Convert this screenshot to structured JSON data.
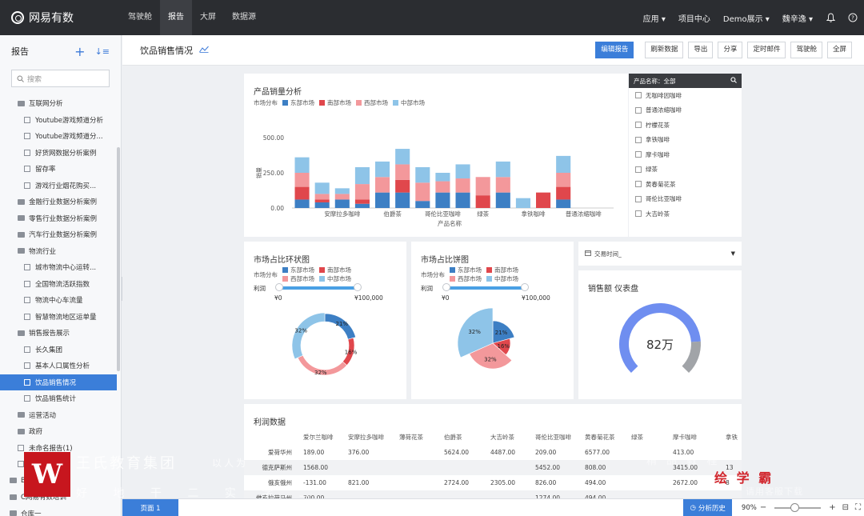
{
  "app": {
    "name": "网易有数"
  },
  "nav": [
    "驾驶舱",
    "报告",
    "大屏",
    "数据源"
  ],
  "nav_active": 1,
  "top_right": {
    "apps": "应用 ▾",
    "project": "项目中心",
    "demo": "Demo展示 ▾",
    "user": "魏辛逸 ▾"
  },
  "sidebar": {
    "title": "报告",
    "search_placeholder": "搜索",
    "items": [
      {
        "type": "folder",
        "level": 1,
        "label": "互联网分析"
      },
      {
        "type": "file",
        "level": 2,
        "label": "Youtube游戏频道分析"
      },
      {
        "type": "file",
        "level": 2,
        "label": "Youtube游戏频道分..."
      },
      {
        "type": "file",
        "level": 2,
        "label": "好货网数据分析案例"
      },
      {
        "type": "file",
        "level": 2,
        "label": "留存率"
      },
      {
        "type": "file",
        "level": 2,
        "label": "游戏行业烟花购买..."
      },
      {
        "type": "folder",
        "level": 1,
        "label": "金融行业数据分析案例"
      },
      {
        "type": "folder",
        "level": 1,
        "label": "零售行业数据分析案例"
      },
      {
        "type": "folder",
        "level": 1,
        "label": "汽车行业数据分析案例"
      },
      {
        "type": "folder",
        "level": 1,
        "label": "物流行业"
      },
      {
        "type": "file",
        "level": 2,
        "label": "城市物流中心运转..."
      },
      {
        "type": "file",
        "level": 2,
        "label": "全国物流活跃指数"
      },
      {
        "type": "file",
        "level": 2,
        "label": "物流中心车流量"
      },
      {
        "type": "file",
        "level": 2,
        "label": "智慧物流地区运单量"
      },
      {
        "type": "folder",
        "level": 1,
        "label": "销售报告展示"
      },
      {
        "type": "file",
        "level": 2,
        "label": "长久集团"
      },
      {
        "type": "file",
        "level": 2,
        "label": "基本人口属性分析"
      },
      {
        "type": "file",
        "level": 2,
        "label": "饮品销售情况",
        "selected": true
      },
      {
        "type": "file",
        "level": 2,
        "label": "饮品销售统计"
      },
      {
        "type": "folder",
        "level": 1,
        "label": "运营活动"
      },
      {
        "type": "folder",
        "level": 1,
        "label": "政府"
      },
      {
        "type": "file",
        "level": 1,
        "label": "未命名报告(1)"
      },
      {
        "type": "file",
        "level": 1,
        "label": ""
      },
      {
        "type": "folder",
        "level": 0,
        "label": "B"
      },
      {
        "type": "folder",
        "level": 0,
        "label": "C网易有数培训"
      },
      {
        "type": "folder",
        "level": 0,
        "label": "仓库一"
      }
    ]
  },
  "page": {
    "title": "饮品销售情况",
    "buttons": [
      "刷新数据",
      "导出",
      "分享",
      "定时邮件",
      "驾驶舱",
      "全屏"
    ],
    "edit_button": "编辑报告"
  },
  "colors": {
    "east": "#3d7fc4",
    "south": "#e0474c",
    "west": "#f3989b",
    "middle": "#8ec4e8",
    "accent": "#3b7ed9",
    "gauge": "#6f8ef0",
    "gauge_rest": "#a1a4a8"
  },
  "bar_panel": {
    "title": "产品销量分析",
    "legend_label": "市场分布",
    "ylabel": "销量",
    "xlabel": "产品名称"
  },
  "chart_data": [
    {
      "type": "bar",
      "stacked": true,
      "title": "产品销量分析",
      "xlabel": "产品名称",
      "ylabel": "销量",
      "ylim": [
        0,
        500
      ],
      "yticks": [
        "0.00",
        "250.00",
        "500.00"
      ],
      "x_tick_labels": [
        "安摩拉多咖啡",
        "伯爵茶",
        "哥伦比亚咖啡",
        "绿茶",
        "拿铁咖啡",
        "普通浓缩咖啡"
      ],
      "categories": [
        "c1",
        "c2",
        "c3",
        "c4",
        "c5",
        "c6",
        "c7",
        "c8",
        "c9",
        "c10",
        "c11",
        "c12",
        "c13",
        "c14",
        "c15",
        "c16"
      ],
      "series": [
        {
          "name": "东部市场",
          "values": [
            60,
            40,
            60,
            30,
            110,
            110,
            50,
            110,
            110,
            0,
            110,
            0,
            0,
            60,
            0,
            0
          ]
        },
        {
          "name": "南部市场",
          "values": [
            90,
            20,
            0,
            30,
            0,
            90,
            0,
            0,
            0,
            90,
            0,
            0,
            110,
            90,
            0,
            0
          ]
        },
        {
          "name": "西部市场",
          "values": [
            100,
            40,
            40,
            110,
            110,
            110,
            130,
            80,
            100,
            130,
            110,
            0,
            0,
            100,
            0,
            0
          ]
        },
        {
          "name": "中部市场",
          "values": [
            110,
            80,
            40,
            120,
            110,
            110,
            110,
            60,
            100,
            0,
            110,
            70,
            0,
            120,
            0,
            0
          ]
        }
      ],
      "legend": "top-left",
      "grid": false
    },
    {
      "type": "pie",
      "variant": "donut",
      "title": "市场占比环状图",
      "series": [
        {
          "name": "东部市场",
          "value": 21,
          "label": "21%"
        },
        {
          "name": "南部市场",
          "value": 16,
          "label": "16%"
        },
        {
          "name": "西部市场",
          "value": 32,
          "label": "32%"
        },
        {
          "name": "中部市场",
          "value": 32,
          "label": "32%"
        }
      ]
    },
    {
      "type": "pie",
      "variant": "rose",
      "title": "市场占比饼图",
      "series": [
        {
          "name": "东部市场",
          "value": 21,
          "label": "21%"
        },
        {
          "name": "南部市场",
          "value": 16,
          "label": "16%"
        },
        {
          "name": "西部市场",
          "value": 32,
          "label": "32%"
        },
        {
          "name": "中部市场",
          "value": 32,
          "label": "32%"
        }
      ]
    },
    {
      "type": "gauge",
      "title": "销售额 仪表盘",
      "value_label": "82万",
      "fraction": 0.82
    }
  ],
  "ring_panel": {
    "title": "市场占比环状图",
    "legend_label": "市场分布",
    "profit_label": "利润",
    "min": "¥0",
    "max": "¥100,000"
  },
  "pie_panel": {
    "title": "市场占比饼图",
    "legend_label": "市场分布",
    "profit_label": "利润",
    "min": "¥0",
    "max": "¥100,000"
  },
  "legend_items": [
    "东部市场",
    "南部市场",
    "西部市场",
    "中部市场"
  ],
  "filter": {
    "header": "产品名称：全部",
    "options": [
      "无咖啡因咖啡",
      "普通浓缩咖啡",
      "柠檬花茶",
      "拿铁咖啡",
      "摩卡咖啡",
      "绿茶",
      "黄春菊花茶",
      "哥伦比亚咖啡",
      "大吉岭茶"
    ]
  },
  "date_filter": {
    "label": "交易时间_"
  },
  "gauge_panel": {
    "title": "销售额 仪表盘"
  },
  "profit_table": {
    "title": "利润数据",
    "columns": [
      "",
      "爱尔兰咖啡",
      "安摩拉多咖啡",
      "薄荷花茶",
      "伯爵茶",
      "大吉岭茶",
      "哥伦比亚咖啡",
      "黄春菊花茶",
      "绿茶",
      "摩卡咖啡",
      "拿铁"
    ],
    "rows": [
      [
        "爱荷华州",
        "189.00",
        "376.00",
        "",
        "5624.00",
        "4487.00",
        "209.00",
        "6577.00",
        "",
        "413.00",
        ""
      ],
      [
        "德克萨斯州",
        "1568.00",
        "",
        "",
        "",
        "",
        "5452.00",
        "808.00",
        "",
        "3415.00",
        "13"
      ],
      [
        "俄亥俄州",
        "-131.00",
        "821.00",
        "",
        "2724.00",
        "2305.00",
        "826.00",
        "494.00",
        "",
        "2672.00",
        "8"
      ],
      [
        "佛克拉荷马州",
        "700.00",
        "",
        "",
        "",
        "",
        "1274.00",
        "494.00",
        "",
        "",
        ""
      ]
    ]
  },
  "statusbar": {
    "page_tab": "页面 1",
    "history": "分析历史",
    "zoom": "90%"
  },
  "watermark": {
    "logo_letter": "W",
    "line1": "王氏教育集团",
    "line1b": "以人为",
    "line2": "好 地 干 二 实 学 二",
    "right1": "精 品 教 程",
    "right2": "绘 学 霸",
    "right3": "请用客服下载"
  }
}
